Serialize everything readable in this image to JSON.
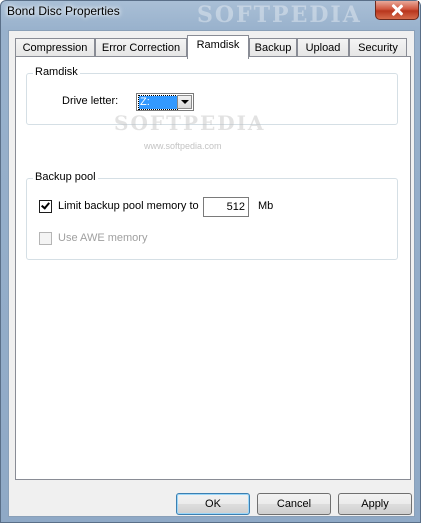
{
  "window": {
    "title": "Bond Disc Properties",
    "watermark": "SOFTPEDIA"
  },
  "tabs": [
    {
      "label": "Compression",
      "active": false
    },
    {
      "label": "Error Correction",
      "active": false
    },
    {
      "label": "Ramdisk",
      "active": true
    },
    {
      "label": "Backup",
      "active": false
    },
    {
      "label": "Upload",
      "active": false
    },
    {
      "label": "Security",
      "active": false
    }
  ],
  "ramdisk": {
    "group_label": "Ramdisk",
    "drive_letter_label": "Drive letter:",
    "drive_letter_value": "Z:"
  },
  "backup_pool": {
    "group_label": "Backup pool",
    "limit_label": "Limit backup pool memory to",
    "limit_checked": true,
    "memory_value": "512",
    "unit": "Mb",
    "awe_label": "Use AWE memory",
    "awe_checked": false,
    "awe_enabled": false
  },
  "watermark": {
    "text": "SOFTPEDIA",
    "url": "www.softpedia.com"
  },
  "buttons": {
    "ok": "OK",
    "cancel": "Cancel",
    "apply": "Apply"
  },
  "colors": {
    "selection": "#3399ff",
    "title_gradient": "#98b1cc",
    "close_button": "#c8462c"
  }
}
